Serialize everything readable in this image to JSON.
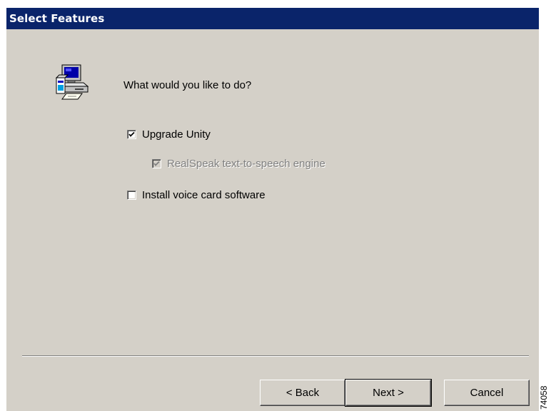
{
  "window": {
    "title": "Select Features"
  },
  "colors": {
    "titlebar": "#0a246a",
    "dialog_bg": "#d4d0c8",
    "disabled_text": "#808080"
  },
  "icon": {
    "name": "setup-computer-icon"
  },
  "prompt": "What would you like to do?",
  "options": [
    {
      "label": "Upgrade Unity",
      "checked": true,
      "enabled": true
    },
    {
      "label": "RealSpeak text-to-speech engine",
      "checked": true,
      "enabled": false
    },
    {
      "label": "Install voice card software",
      "checked": false,
      "enabled": true
    }
  ],
  "buttons": {
    "back": "< Back",
    "next": "Next >",
    "cancel": "Cancel"
  },
  "figure_number": "74058"
}
